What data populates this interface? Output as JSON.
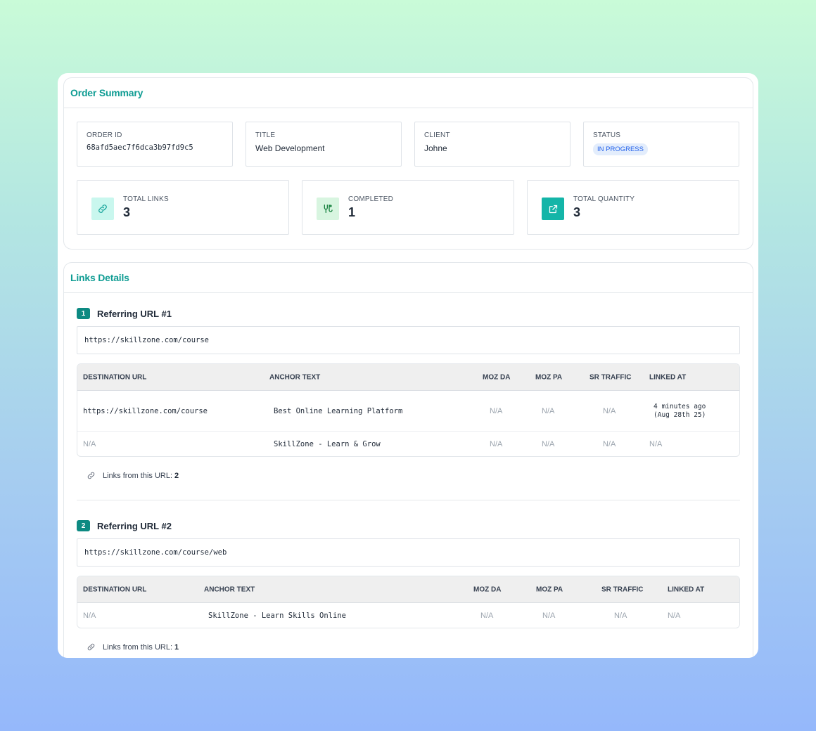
{
  "summary": {
    "title": "Order Summary",
    "order_id": {
      "label": "ORDER ID",
      "value": "68afd5aec7f6dca3b97fd9c5"
    },
    "title_field": {
      "label": "TITLE",
      "value": "Web Development"
    },
    "client": {
      "label": "CLIENT",
      "value": "Johne"
    },
    "status": {
      "label": "STATUS",
      "value": "IN PROGRESS"
    },
    "stats": {
      "total_links": {
        "label": "TOTAL LINKS",
        "value": "3",
        "icon": "link-icon"
      },
      "completed": {
        "label": "COMPLETED",
        "value": "1",
        "icon": "route-icon"
      },
      "total_quantity": {
        "label": "TOTAL QUANTITY",
        "value": "3",
        "icon": "external-link-icon"
      }
    }
  },
  "links": {
    "title": "Links Details",
    "groups": [
      {
        "number": "1",
        "title": "Referring URL #1",
        "url": "https://skillzone.com/course",
        "headers": {
          "destination": "DESTINATION URL",
          "anchor": "ANCHOR TEXT",
          "moz_da": "MOZ DA",
          "moz_pa": "MOZ PA",
          "sr_traffic": "SR TRAFFIC",
          "linked_at": "LINKED AT"
        },
        "rows": [
          {
            "destination": "https://skillzone.com/course",
            "anchor": "Best Online Learning Platform",
            "moz_da": "N/A",
            "moz_pa": "N/A",
            "sr_traffic": "N/A",
            "linked_at_1": "4 minutes ago",
            "linked_at_2": "(Aug 28th 25)"
          },
          {
            "destination": "N/A",
            "anchor": "SkillZone - Learn & Grow",
            "moz_da": "N/A",
            "moz_pa": "N/A",
            "sr_traffic": "N/A",
            "linked_at": "N/A"
          }
        ],
        "links_from_label": "Links from this URL:",
        "links_from_count": "2"
      },
      {
        "number": "2",
        "title": "Referring URL #2",
        "url": "https://skillzone.com/course/web",
        "headers": {
          "destination": "DESTINATION URL",
          "anchor": "ANCHOR TEXT",
          "moz_da": "MOZ DA",
          "moz_pa": "MOZ PA",
          "sr_traffic": "SR TRAFFIC",
          "linked_at": "LINKED AT"
        },
        "rows": [
          {
            "destination": "N/A",
            "anchor": "SkillZone - Learn Skills Online",
            "moz_da": "N/A",
            "moz_pa": "N/A",
            "sr_traffic": "N/A",
            "linked_at": "N/A"
          }
        ],
        "links_from_label": "Links from this URL:",
        "links_from_count": "1"
      }
    ]
  },
  "colors": {
    "accent": "#0f9c93",
    "badge_text": "#2563eb",
    "badge_bg": "#e3edfc",
    "number_badge": "#0d8a82"
  }
}
